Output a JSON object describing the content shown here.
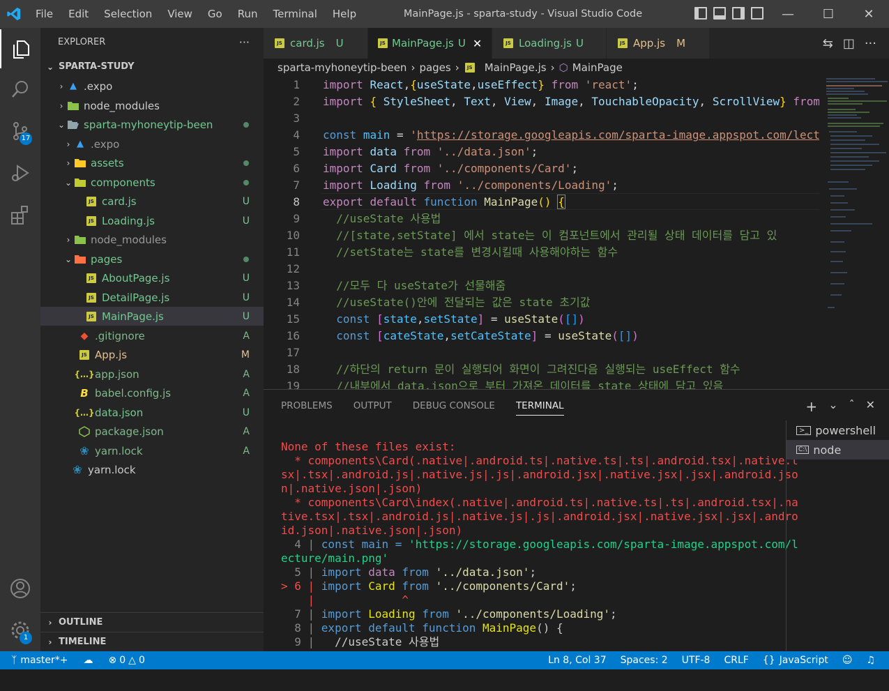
{
  "titlebar": {
    "menu": [
      "File",
      "Edit",
      "Selection",
      "View",
      "Go",
      "Run",
      "Terminal",
      "Help"
    ],
    "title": "MainPage.js - sparta-study - Visual Studio Code"
  },
  "activity": {
    "scm_badge": "17",
    "settings_badge": "1"
  },
  "explorer": {
    "header": "EXPLORER",
    "more": "···",
    "root": "SPARTA-STUDY",
    "items": [
      {
        "label": ".expo",
        "status": ""
      },
      {
        "label": "node_modules",
        "status": ""
      },
      {
        "label": "sparta-myhoneytip-been",
        "status": ""
      },
      {
        "label": ".expo",
        "status": ""
      },
      {
        "label": "assets",
        "status": ""
      },
      {
        "label": "components",
        "status": ""
      },
      {
        "label": "card.js",
        "status": "U"
      },
      {
        "label": "Loading.js",
        "status": "U"
      },
      {
        "label": "node_modules",
        "status": ""
      },
      {
        "label": "pages",
        "status": ""
      },
      {
        "label": "AboutPage.js",
        "status": "U"
      },
      {
        "label": "DetailPage.js",
        "status": "U"
      },
      {
        "label": "MainPage.js",
        "status": "U"
      },
      {
        "label": ".gitignore",
        "status": "A"
      },
      {
        "label": "App.js",
        "status": "M"
      },
      {
        "label": "app.json",
        "status": "A"
      },
      {
        "label": "babel.config.js",
        "status": "A"
      },
      {
        "label": "data.json",
        "status": "U"
      },
      {
        "label": "package.json",
        "status": "A"
      },
      {
        "label": "yarn.lock",
        "status": "A"
      },
      {
        "label": "yarn.lock",
        "status": ""
      }
    ],
    "outline": "OUTLINE",
    "timeline": "TIMELINE"
  },
  "tabs": [
    {
      "label": "card.js",
      "status": "U"
    },
    {
      "label": "MainPage.js",
      "status": "U"
    },
    {
      "label": "Loading.js",
      "status": "U"
    },
    {
      "label": "App.js",
      "status": "M"
    }
  ],
  "breadcrumb": {
    "folder": "sparta-myhoneytip-been",
    "sub": "pages",
    "file": "MainPage.js",
    "symbol": "MainPage"
  },
  "editor": {
    "line_numbers": [
      "1",
      "2",
      "3",
      "4",
      "5",
      "6",
      "7",
      "8",
      "9",
      "10",
      "11",
      "12",
      "13",
      "14",
      "15",
      "16",
      "17",
      "18",
      "19"
    ],
    "current_line": "8"
  },
  "panel": {
    "tabs": [
      "PROBLEMS",
      "OUTPUT",
      "DEBUG CONSOLE",
      "TERMINAL"
    ],
    "terminals": [
      "powershell",
      "node"
    ],
    "term_lines": {
      "err": "None of these files exist:",
      "l1": "  * components\\Card(.native|.android.ts|.native.ts|.ts|.android.tsx|.native.t",
      "l2": "sx|.tsx|.android.js|.native.js|.js|.android.jsx|.native.jsx|.jsx|.android.jso",
      "l3": "n|.native.json|.json)",
      "l4": "  * components\\Card\\index(.native|.android.ts|.native.ts|.ts|.android.tsx|.na",
      "l5": "tive.tsx|.tsx|.android.js|.native.js|.js|.android.jsx|.native.jsx|.jsx|.andro",
      "l6": "id.json|.native.json|.json)",
      "c4a": "  4 | ",
      "c4b": "const main = ",
      "c4c": "'https://storage.googleapis.com/sparta-image.appspot.com/l",
      "c4d": "ecture/main.png'",
      "c5a": "  5 | ",
      "c6a": "> 6 | ",
      "caret": "    |             ^",
      "c7a": "  7 | ",
      "c8a": "  8 | ",
      "c9a": "  9 | ",
      "c9b": "  //useState 사용법",
      "cursor": "▯"
    }
  },
  "status": {
    "branch": "master*+",
    "errors": "0",
    "warnings": "0",
    "position": "Ln 8, Col 37",
    "spaces": "Spaces: 2",
    "encoding": "UTF-8",
    "eol": "CRLF",
    "language": "JavaScript"
  }
}
